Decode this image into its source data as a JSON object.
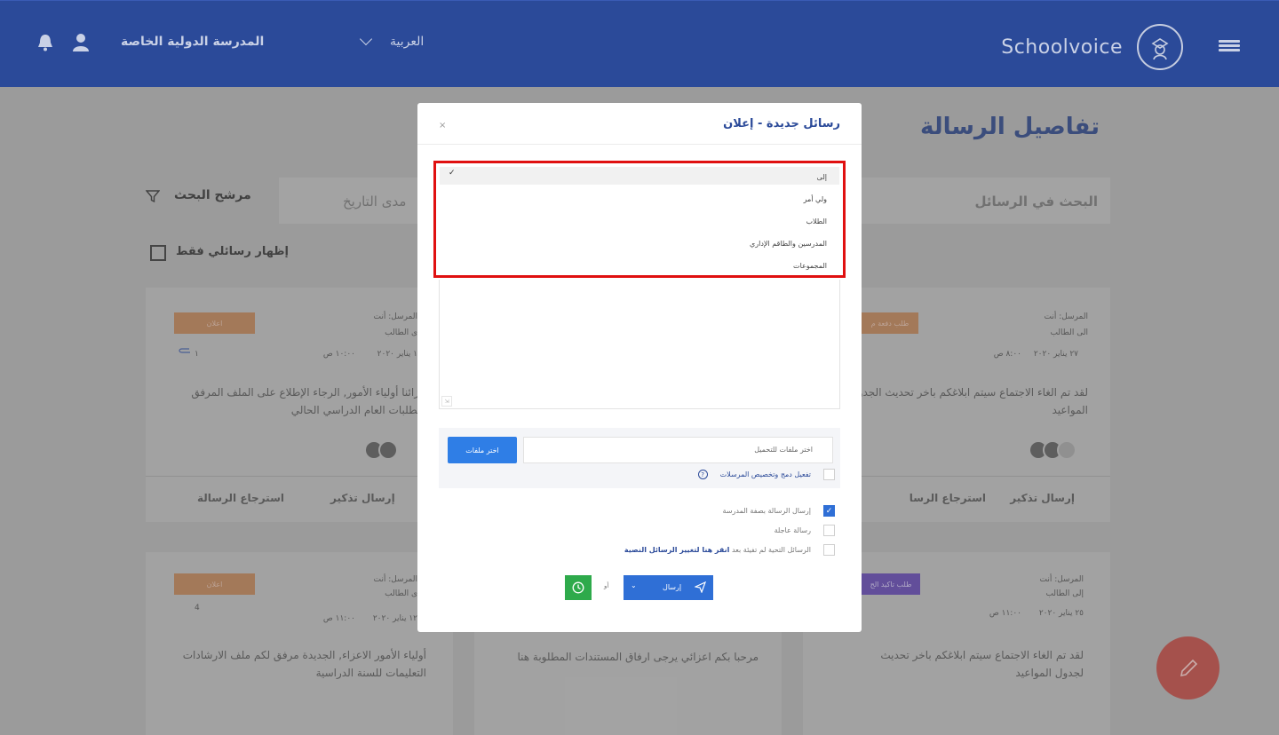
{
  "header": {
    "brand_name": "Schoolvoice",
    "language": "العربية",
    "school_name": "المدرسة الدولية الخاصة",
    "icons": [
      "menu-icon",
      "logo-icon",
      "chevron-down-icon",
      "user-icon",
      "bell-icon"
    ]
  },
  "page": {
    "title": "تفاصيل الرسالة",
    "search_label": "البحث في الرسائل",
    "date_range_label": "مدى التاريخ",
    "filter_label": "مرشح البحث",
    "only_mine_label": "إظهار رسائلي فقط"
  },
  "cards": [
    {
      "badge": "طلب دفعة م",
      "sender": "المرسل: أنت",
      "to": "الى الطالب",
      "date": "٢٧ يناير ٢٠٢٠",
      "time": "٨:٠٠ ص",
      "text": "لقد تم الغاء الاجتماع سيتم ابلاغكم باخر تحديث الجدول المواعيد",
      "actions": [
        "إرسال تذكير",
        "استرجاع الرسا"
      ]
    },
    {
      "badge": "اعلان",
      "sender": "المرسل: أنت",
      "to": "ى الطالب",
      "date": "١ يناير ٢٠٢٠",
      "time": "١٠:٠٠ ص",
      "attachments": "١",
      "text": "عزائنا أولياء الأمور, الرجاء الإطلاع على الملف المرفق متطلبات العام الدراسي الحالي",
      "actions": [
        "إرسال تذكير",
        "استرجاع الرسالة"
      ]
    },
    {
      "badge": "اعلان",
      "sender": "المرسل: أنت",
      "to": "ى الطالب",
      "date": "١٢ يناير ٢٠٢٠",
      "time": "١١:٠٠ ص",
      "attachments": "4",
      "text": "أولياء الأمور الاعزاء, الجديدة  مرفق لكم ملف الارشادات التعليمات للسنة الدراسية"
    },
    {
      "text": "مرحبا بكم اعزائي يرجى ارفاق المستندات المطلوبة هنا"
    },
    {
      "badge": "طلب تاكيد الح",
      "sender": "المرسل: أنت",
      "to": "إلى الطالب",
      "date": "٢٥ يناير ٢٠٢٠",
      "time": "١١:٠٠ ص",
      "text": "لقد تم الغاء الاجتماع سيتم ابلاغكم باخر تحديث لجدول المواعيد"
    }
  ],
  "modal": {
    "title": "رسائل جديدة - إعلان",
    "close": "×",
    "recipient_dropdown": {
      "selected": "إلى",
      "options": [
        "إلى",
        "ولي أمر",
        "الطلاب",
        "المدرسين والطاقم الإداري",
        "المجموعات"
      ]
    },
    "upload": {
      "placeholder": "اختر ملفات للتحميل",
      "button": "اختر ملفات",
      "merge_label": "تفعيل دمج وتخصيص المرسلات",
      "help": "?"
    },
    "options": [
      {
        "label": "إرسال الرسالة بصفة المدرسة",
        "checked": true
      },
      {
        "label": "رسالة عاجلة",
        "checked": false
      },
      {
        "label_prefix": "الرسائل التحية لم تفيئة بعد ",
        "label_link": "انقر هنا لتغيير الرسائل النصية",
        "checked": false
      }
    ],
    "send_label": "إرسال",
    "or_label": "أو"
  },
  "colors": {
    "header_bg": "#2b4a99",
    "primary_blue": "#2f6fd6",
    "highlight_red": "#e01010",
    "schedule_green": "#2eaa4b",
    "fab_red": "#b8433c"
  }
}
